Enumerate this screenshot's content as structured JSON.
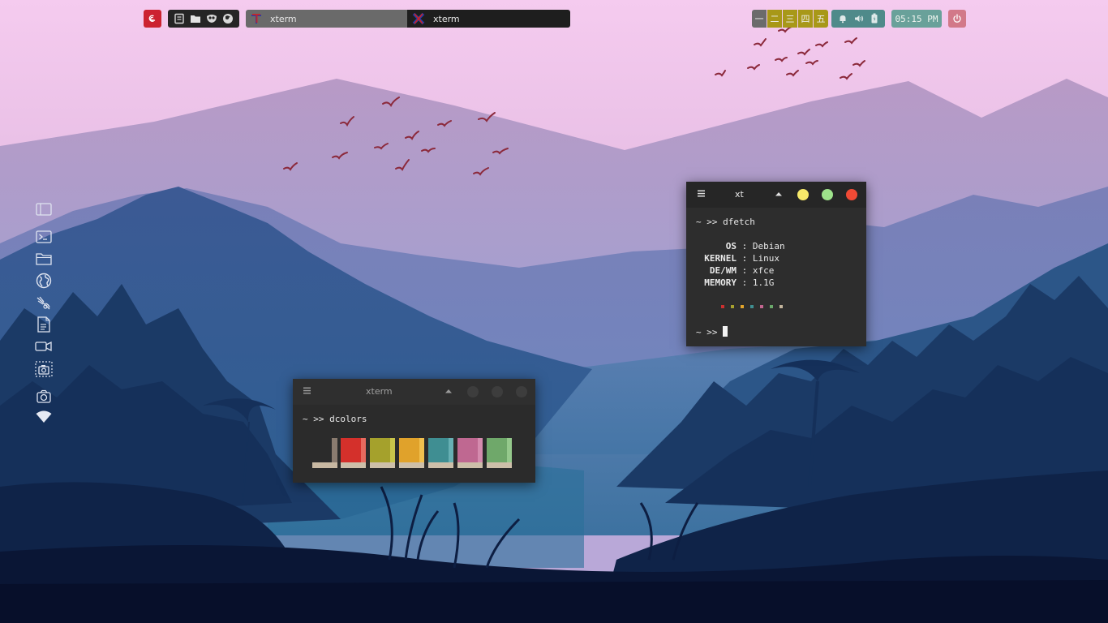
{
  "colors": {
    "sky_top": "#f3c8ef",
    "launcher": "#cc2230",
    "workspace_active": "#6b6b6b",
    "workspace_inactive": "#a89818",
    "systray": "#4f8a8a",
    "clock": "#69a19a",
    "power": "#d27989"
  },
  "panel": {
    "launcher_icon": "debian-logo-icon",
    "quicklaunch_icons": [
      "notes-icon",
      "folder-icon",
      "gimp-icon",
      "firefox-icon"
    ],
    "tasks": [
      {
        "label": "xterm",
        "icon": "xterm-t-icon",
        "active": true
      },
      {
        "label": "xterm",
        "icon": "xterm-x-icon",
        "active": false
      }
    ],
    "workspaces": [
      "一",
      "二",
      "三",
      "四",
      "五"
    ],
    "systray_icons": [
      "bell-icon",
      "volume-icon",
      "battery-icon"
    ],
    "clock": "05:15 PM",
    "power_icon": "power-icon"
  },
  "dock": {
    "icons": [
      "sidebar-icon",
      "terminal-icon",
      "folder-icon",
      "globe-icon",
      "gimp-icon",
      "document-icon",
      "video-camera-icon",
      "screenshot-icon",
      "camera-icon",
      "wifi-icon"
    ]
  },
  "window_xt": {
    "title": "xt",
    "prompt": "~ >>",
    "command": "dfetch",
    "info": [
      {
        "key": "OS",
        "value": "Debian"
      },
      {
        "key": "KERNEL",
        "value": "Linux"
      },
      {
        "key": "DE/WM",
        "value": "xfce"
      },
      {
        "key": "MEMORY",
        "value": "1.1G"
      }
    ],
    "sep": ":",
    "palette": [
      "#cc2f2f",
      "#a8a12f",
      "#e3a42b",
      "#3f8f91",
      "#c2658f",
      "#6aa86a",
      "#c3b49c"
    ],
    "prompt2": "~ >>",
    "buttons": {
      "minimize": "#f7e96a",
      "maximize": "#9ee38b",
      "close": "#f04a35"
    }
  },
  "window_dc": {
    "title": "xterm",
    "prompt": "~ >>",
    "command": "dcolors",
    "blocks": [
      {
        "name": "neutral",
        "color": "#8a7b6f",
        "light": "#c8b8a2"
      },
      {
        "name": "red",
        "color": "#d4302b",
        "light": "#e86a5e"
      },
      {
        "name": "yellow",
        "color": "#a5a12c",
        "light": "#c8c44a"
      },
      {
        "name": "orange",
        "color": "#e0a22b",
        "light": "#f0bf4e"
      },
      {
        "name": "cyan",
        "color": "#3f8e92",
        "light": "#67b0b4"
      },
      {
        "name": "magenta",
        "color": "#bf6891",
        "light": "#d58bae"
      },
      {
        "name": "green",
        "color": "#6fa86a",
        "light": "#95c98c"
      }
    ]
  }
}
